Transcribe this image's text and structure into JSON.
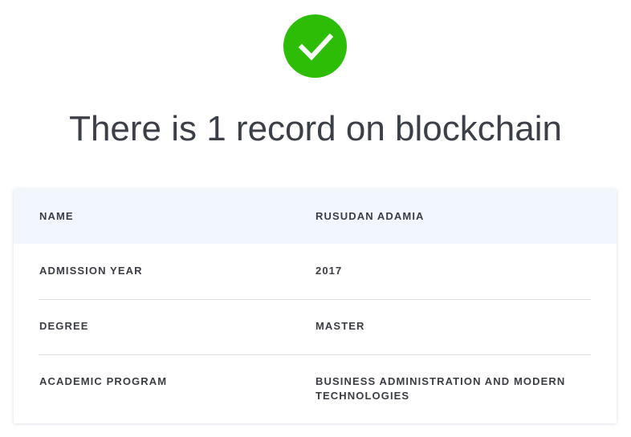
{
  "status": {
    "icon": "check-circle-icon",
    "color": "#2ebd06",
    "headline": "There is 1 record on blockchain"
  },
  "record": {
    "rows": [
      {
        "label": "NAME",
        "value": "RUSUDAN ADAMIA"
      },
      {
        "label": "ADMISSION YEAR",
        "value": "2017"
      },
      {
        "label": "DEGREE",
        "value": "MASTER"
      },
      {
        "label": "ACADEMIC PROGRAM",
        "value": "BUSINESS ADMINISTRATION AND MODERN TECHNOLOGIES"
      }
    ]
  },
  "colors": {
    "header_row_bg": "#f2f6fd",
    "text": "#3a3d44",
    "divider": "#dcdfe4"
  }
}
